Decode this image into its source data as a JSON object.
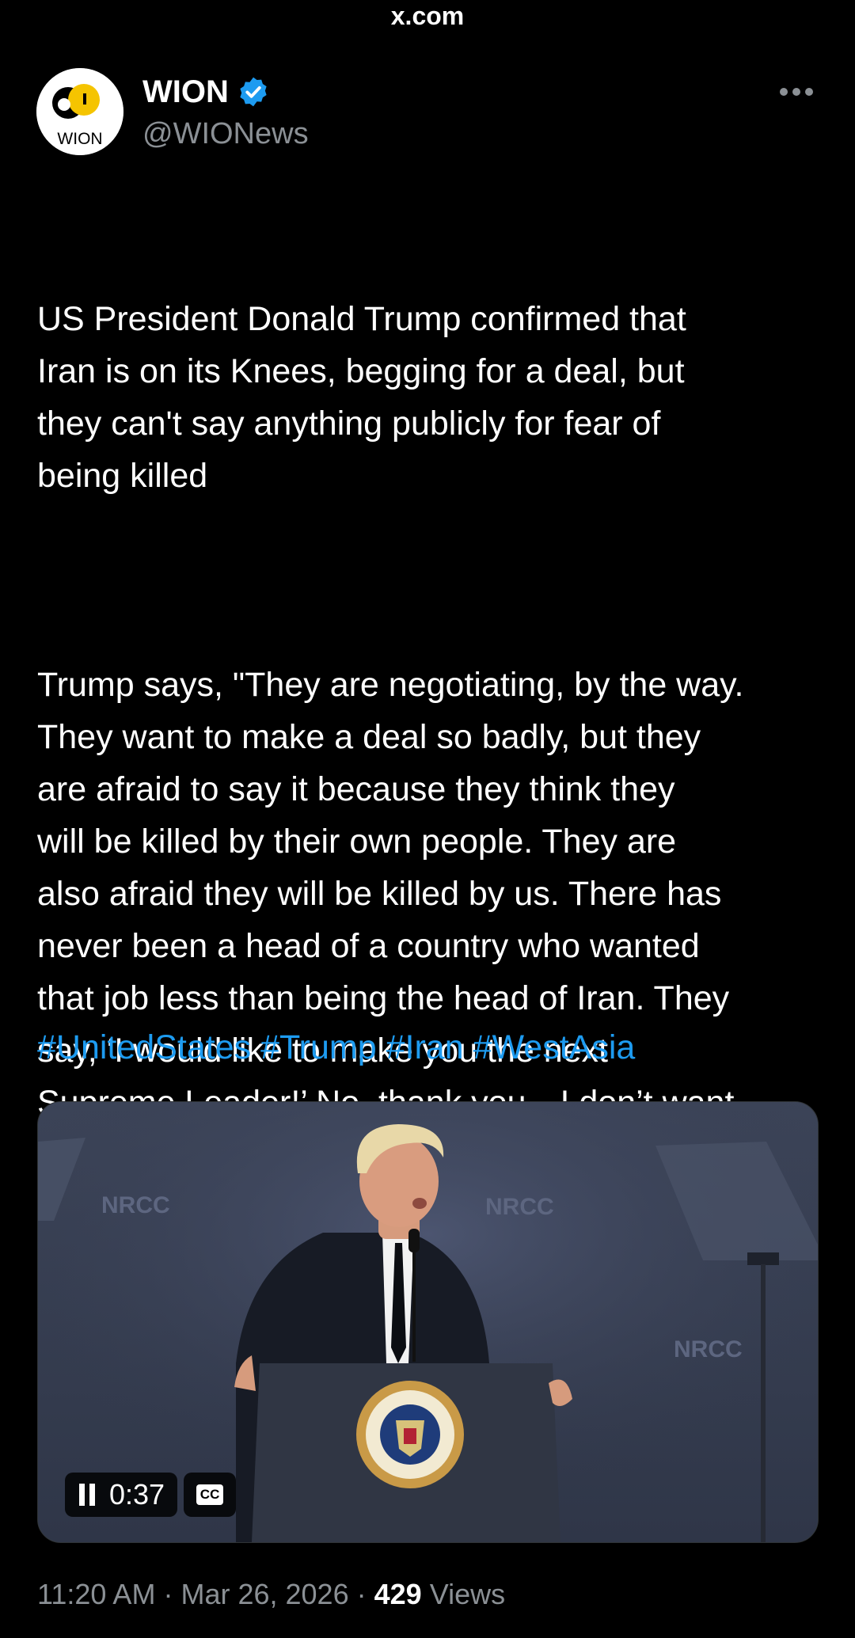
{
  "browser": {
    "url": "x.com"
  },
  "author": {
    "display_name": "WION",
    "handle": "@WIONews",
    "avatar_text": "WION",
    "verified_icon": "verified-badge-icon",
    "verified_color": "#1d9bf0"
  },
  "tweet": {
    "paragraphs": [
      "US President Donald Trump confirmed that\nIran is on its Knees, begging for a deal, but\nthey can't say anything publicly for fear of\nbeing killed",
      "Trump says, \"They are negotiating, by the way.\nThey want to make a deal so badly, but they\nare afraid to say it because they think they\nwill be killed by their own people. They are\nalso afraid they will be killed by us. There has\nnever been a head of a country who wanted\nthat job less than being the head of Iran. They\nsay, ‘I would like to make you the next\nSupreme Leader!’ No, thank you—I don’t want\nit\""
    ],
    "hashtags": [
      "#UnitedStates",
      "#Trump",
      "#Iran",
      "#WestAsia"
    ],
    "hashtag_color": "#1d9bf0"
  },
  "media": {
    "type": "video",
    "elapsed": "0:37",
    "captions_label": "CC",
    "backdrop_text": [
      "NRCC",
      "NRCC",
      "NRCC"
    ],
    "seal_text": "SEAL OF THE PRESIDENT OF THE UNITED STATES"
  },
  "meta": {
    "time": "11:20 AM",
    "separator": "·",
    "date": "Mar 26, 2026",
    "views_count": "429",
    "views_label": "Views"
  },
  "colors": {
    "background": "#000000",
    "text": "#ffffff",
    "secondary_text": "#8b9095",
    "link": "#1d9bf0"
  }
}
